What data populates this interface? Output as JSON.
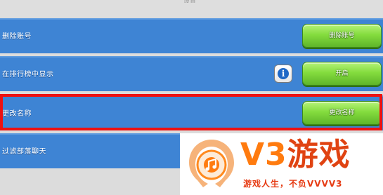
{
  "header": {
    "title": "设置"
  },
  "rows": [
    {
      "label": "删除账号",
      "button": "删除账号",
      "has_info": false
    },
    {
      "label": "在排行榜中显示",
      "button": "开启",
      "has_info": true
    },
    {
      "label": "更改名称",
      "button": "更改名称",
      "has_info": false,
      "highlighted": true
    },
    {
      "label": "过滤部落聊天",
      "button": "",
      "has_info": false
    }
  ],
  "info_button": {
    "glyph": "i",
    "icon": "info-icon"
  },
  "watermark": {
    "brand_v3": "V3",
    "brand_game": "游戏",
    "slogan": "游戏人生，不负VVVV3",
    "logo_icon": "music-disc-icon"
  },
  "colors": {
    "row_bg": "#3e84d4",
    "button_green": "#84dc3e",
    "highlight": "#ee1111",
    "brand_orange": "#ff7b0f",
    "brand_red": "#e04312"
  }
}
